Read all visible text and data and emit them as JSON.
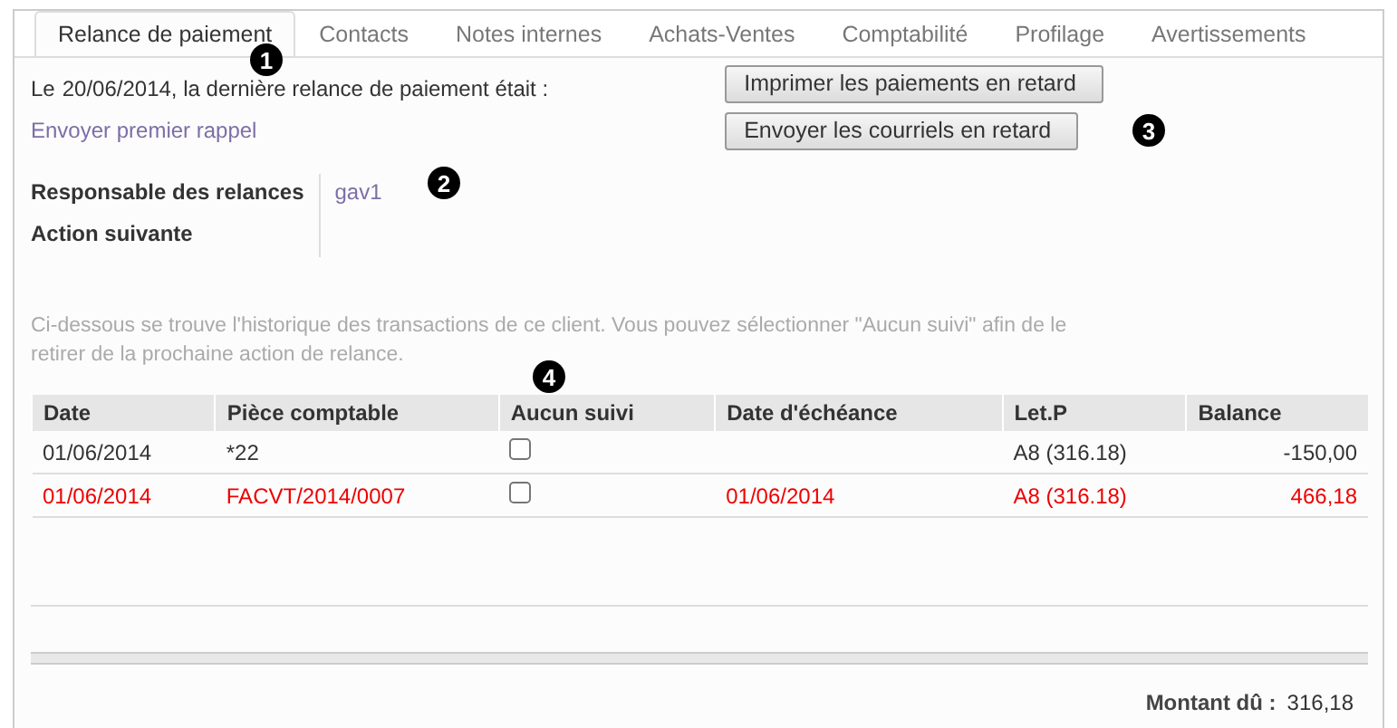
{
  "tabs": [
    {
      "label": "Relance de paiement",
      "selected": true
    },
    {
      "label": "Contacts",
      "selected": false
    },
    {
      "label": "Notes internes",
      "selected": false
    },
    {
      "label": "Achats-Ventes",
      "selected": false
    },
    {
      "label": "Comptabilité",
      "selected": false
    },
    {
      "label": "Profilage",
      "selected": false
    },
    {
      "label": "Avertissements",
      "selected": false
    }
  ],
  "last_followup": {
    "prefix": "Le",
    "date": "20/06/2014",
    "suffix": ", la dernière relance de paiement était :"
  },
  "send_link": "Envoyer premier rappel",
  "buttons": [
    "Imprimer les paiements en retard",
    "Envoyer les courriels en retard"
  ],
  "fields": [
    {
      "label": "Responsable des relances",
      "value": "gav1"
    },
    {
      "label": "Action suivante"
    }
  ],
  "help_text": "Ci-dessous se trouve l'historique des transactions de ce client. Vous pouvez sélectionner \"Aucun suivi\" afin de le retirer de la prochaine action de relance.",
  "table": {
    "columns": [
      "Date",
      "Pièce comptable",
      "Aucun suivi",
      "Date d'échéance",
      "Let.P",
      "Balance"
    ],
    "rows": [
      {
        "overdue": false,
        "date": "01/06/2014",
        "move": "*22",
        "no_followup": false,
        "due_date": "",
        "reconcile": "A8 (316.18)",
        "balance": "-150,00"
      },
      {
        "overdue": true,
        "date": "01/06/2014",
        "move": "FACVT/2014/0007",
        "no_followup": false,
        "due_date": "01/06/2014",
        "reconcile": "A8 (316.18)",
        "balance": "466,18"
      }
    ]
  },
  "total": {
    "label": "Montant dû :",
    "value": "316,18"
  },
  "callouts": [
    "1",
    "2",
    "3",
    "4"
  ]
}
